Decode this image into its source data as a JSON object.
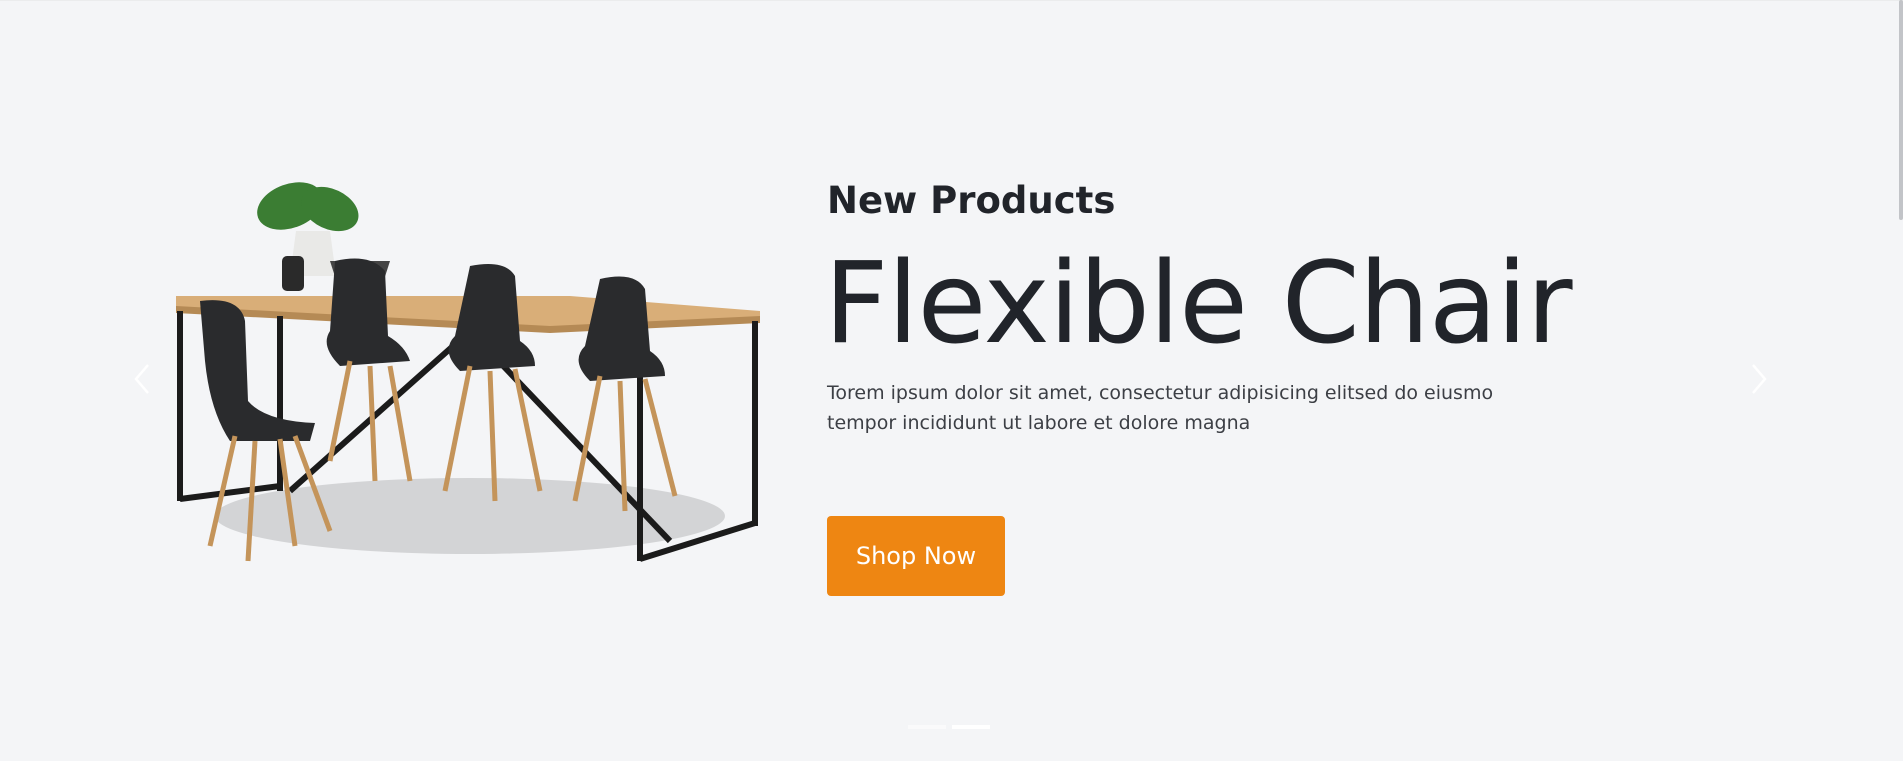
{
  "hero": {
    "eyebrow": "New Products",
    "title": "Flexible Chair",
    "description": "Torem ipsum dolor sit amet, consectetur adipisicing elitsed do eiusmo tempor incididunt ut labore et dolore magna",
    "cta_label": "Shop Now",
    "accent_color": "#ee8612",
    "background_color": "#f4f5f7"
  },
  "carousel": {
    "prev_icon": "chevron-left-icon",
    "next_icon": "chevron-right-icon",
    "slide_count": 2,
    "active_index": 1
  }
}
